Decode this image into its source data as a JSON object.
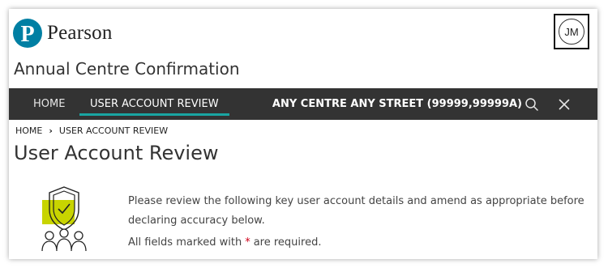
{
  "brand": {
    "name": "Pearson",
    "logo_letter": "P",
    "color": "#007fa3"
  },
  "user": {
    "initials": "JM"
  },
  "app": {
    "title": "Annual Centre Confirmation"
  },
  "nav": {
    "items": [
      {
        "label": "HOME",
        "active": false
      },
      {
        "label": "USER ACCOUNT REVIEW",
        "active": true
      }
    ],
    "centre": "ANY CENTRE ANY STREET (99999,99999A)",
    "search_icon": "search-icon",
    "close_icon": "close-icon",
    "background": "#333333",
    "active_underline": "#19a5a2"
  },
  "breadcrumb": {
    "home": "HOME",
    "separator": "›",
    "current": "USER ACCOUNT REVIEW"
  },
  "page": {
    "title": "User Account Review",
    "intro": "Please review the following key user account details and amend as appropriate before declaring accuracy below.",
    "required_prefix": "All fields marked with",
    "required_marker": "*",
    "required_suffix": "are required."
  },
  "illustration": {
    "icon": "shield-check-users-icon",
    "accent": "#c8d400"
  }
}
